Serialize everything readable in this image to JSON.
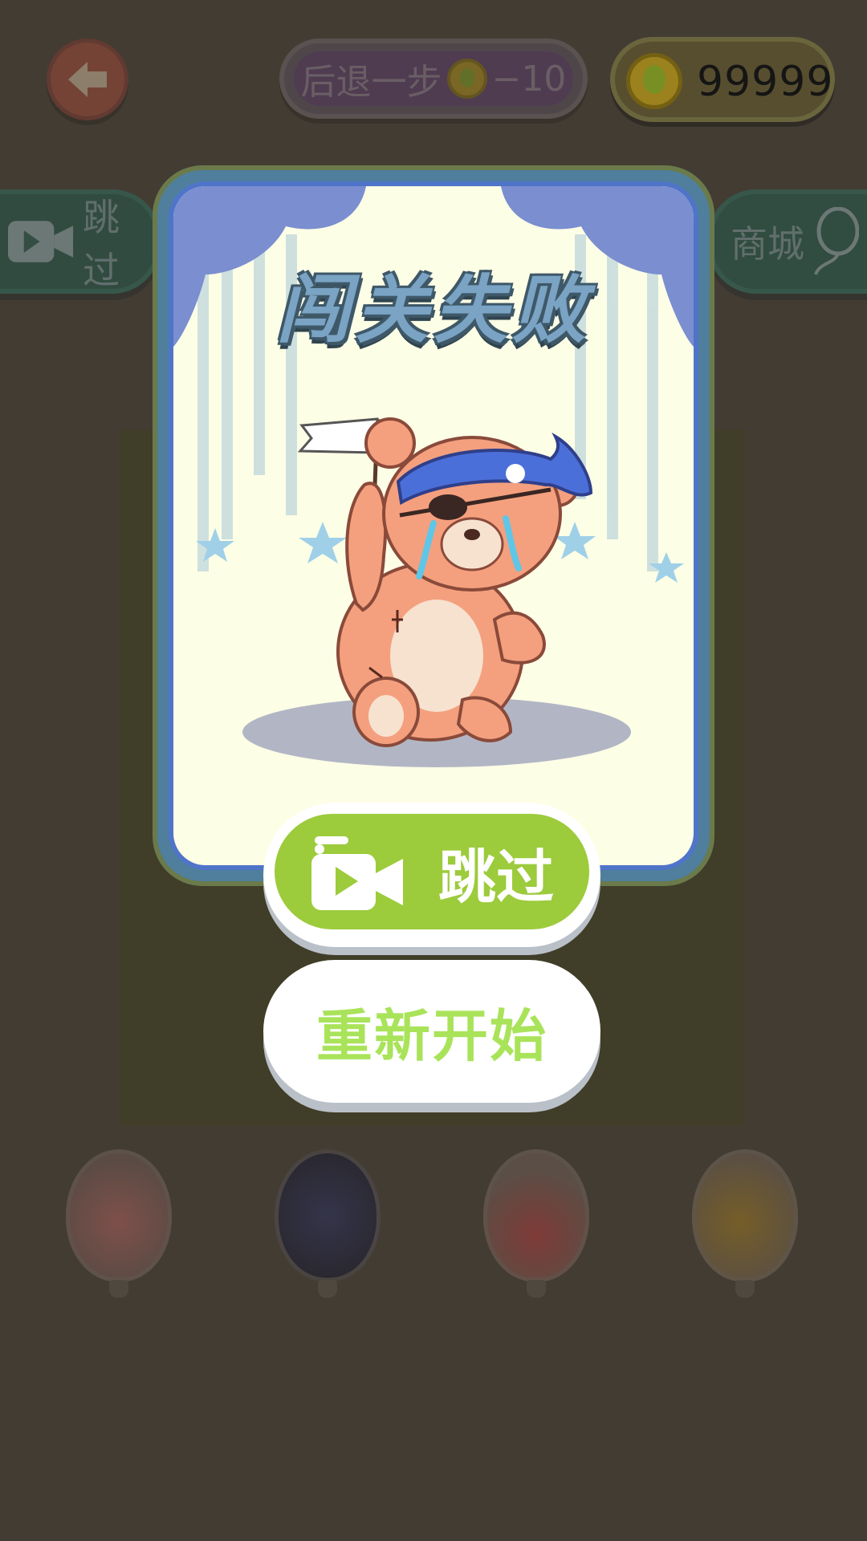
{
  "top_bar": {
    "undo_label": "后退一步",
    "undo_cost": "−10",
    "coins": "99999"
  },
  "side_buttons": {
    "skip_label": "跳过",
    "shop_label": "商城"
  },
  "balloons": [
    "red-glitter-balloon",
    "starry-night-balloon",
    "hearts-balloon",
    "giraffe-balloon"
  ],
  "dialog": {
    "title": "闯关失败",
    "skip_button": "跳过",
    "restart_button": "重新开始"
  },
  "colors": {
    "accent_green": "#9ccb3c",
    "restart_text": "#a9e35a",
    "frame_blue": "#4f74c8"
  }
}
